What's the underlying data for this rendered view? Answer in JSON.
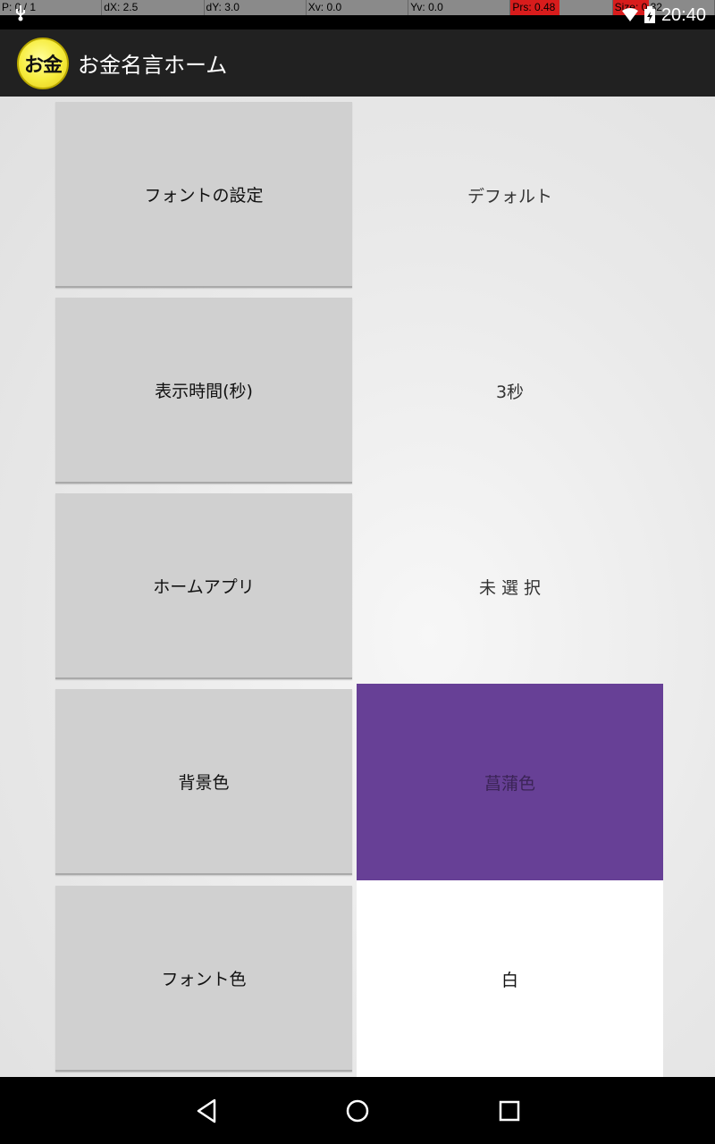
{
  "debug": {
    "p": "P: 0 / 1",
    "dx": "dX: 2.5",
    "dy": "dY: 3.0",
    "xv": "Xv: 0.0",
    "yv": "Yv: 0.0",
    "prs": "Prs: 0.48",
    "size": "Size: 0.32"
  },
  "status": {
    "time": "20:40"
  },
  "app": {
    "logo_text": "お金",
    "title": "お金名言ホーム"
  },
  "settings": [
    {
      "label": "フォントの設定",
      "value": "デフォルト"
    },
    {
      "label": "表示時間(秒)",
      "value": "3秒"
    },
    {
      "label": "ホームアプリ",
      "value": "未 選 択"
    },
    {
      "label": "背景色",
      "value": "菖蒲色",
      "swatch": "#674096"
    },
    {
      "label": "フォント色",
      "value": "白",
      "swatch": "#ffffff"
    }
  ],
  "colors": {
    "app_bar": "#212121",
    "background": "#e9e9e9",
    "button": "#d0d0d0"
  }
}
